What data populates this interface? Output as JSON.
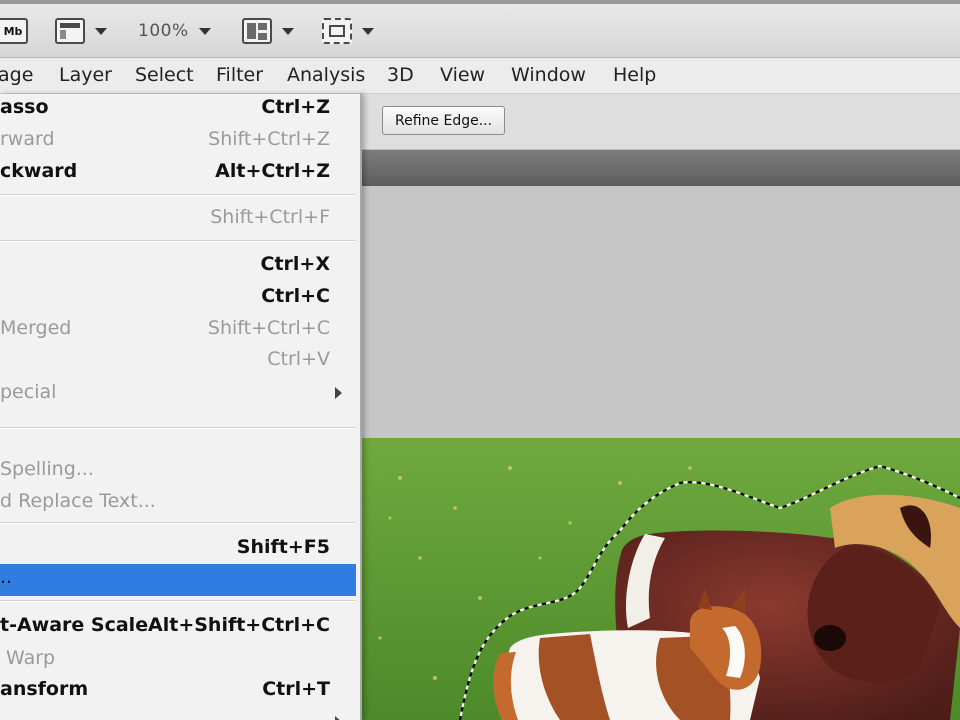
{
  "toolbar": {
    "mb_badge": "Mb",
    "zoom_level": "100%"
  },
  "menubar": {
    "items": [
      {
        "label": "age"
      },
      {
        "label": "Layer"
      },
      {
        "label": "Select"
      },
      {
        "label": "Filter"
      },
      {
        "label": "Analysis"
      },
      {
        "label": "3D"
      },
      {
        "label": "View"
      },
      {
        "label": "Window"
      },
      {
        "label": "Help"
      }
    ]
  },
  "options_bar": {
    "refine_edge_label": "Refine Edge..."
  },
  "edit_menu": {
    "items": [
      {
        "label": "asso",
        "shortcut": "Ctrl+Z"
      },
      {
        "label": "rward",
        "shortcut": "Shift+Ctrl+Z"
      },
      {
        "label": "ckward",
        "shortcut": "Alt+Ctrl+Z"
      },
      {
        "label": "",
        "shortcut": "Shift+Ctrl+F"
      },
      {
        "label": "",
        "shortcut": "Ctrl+X"
      },
      {
        "label": "",
        "shortcut": "Ctrl+C"
      },
      {
        "label": "Merged",
        "shortcut": "Shift+Ctrl+C"
      },
      {
        "label": "",
        "shortcut": "Ctrl+V"
      },
      {
        "label": "pecial",
        "shortcut": ""
      },
      {
        "label": "Spelling...",
        "shortcut": ""
      },
      {
        "label": "d Replace Text...",
        "shortcut": ""
      },
      {
        "label": "",
        "shortcut": "Shift+F5"
      },
      {
        "label": "..",
        "shortcut": ""
      },
      {
        "label": "t-Aware Scale",
        "shortcut": "Alt+Shift+Ctrl+C"
      },
      {
        "label": "Warp",
        "shortcut": ""
      },
      {
        "label": "ansform",
        "shortcut": "Ctrl+T"
      }
    ]
  },
  "colors": {
    "menu_highlight": "#2f7de0",
    "grass": "#5f9e35",
    "pony_brown": "#6e2a22",
    "pony_mane": "#d9a35c"
  }
}
